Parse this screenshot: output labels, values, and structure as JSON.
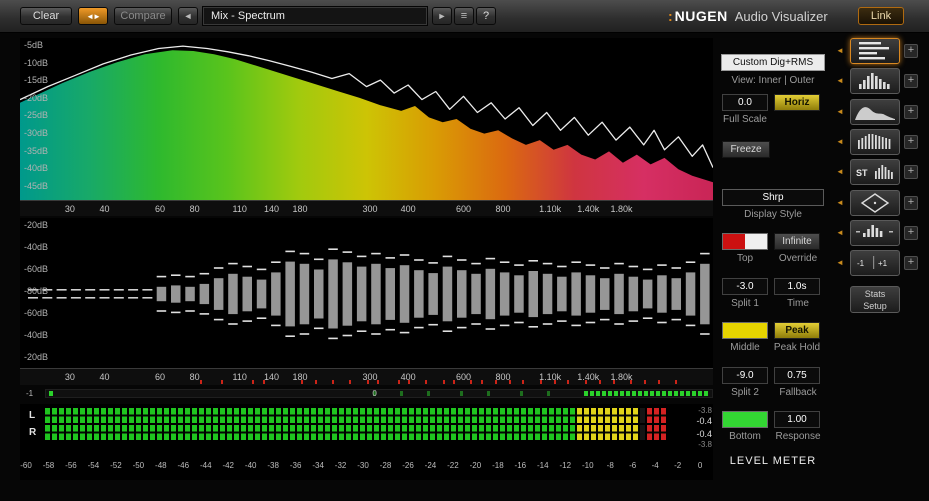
{
  "toolbar": {
    "clear": "Clear",
    "swap_glyph": "◄►",
    "compare": "Compare",
    "prev_glyph": "◄",
    "preset": "Mix - Spectrum",
    "play_glyph": "►",
    "list_glyph": "≡",
    "help": "?",
    "brand_dots": ":",
    "brand_name": "NUGEN",
    "brand_product": "Audio Visualizer",
    "link": "Link"
  },
  "spectrum": {
    "y_labels": [
      "-5dB",
      "-10dB",
      "-15dB",
      "-20dB",
      "-25dB",
      "-30dB",
      "-35dB",
      "-40dB",
      "-45dB"
    ],
    "x_labels": [
      {
        "t": "30",
        "f": 0.072
      },
      {
        "t": "40",
        "f": 0.122
      },
      {
        "t": "60",
        "f": 0.202
      },
      {
        "t": "80",
        "f": 0.252
      },
      {
        "t": "110",
        "f": 0.317
      },
      {
        "t": "140",
        "f": 0.363
      },
      {
        "t": "180",
        "f": 0.404
      },
      {
        "t": "300",
        "f": 0.505
      },
      {
        "t": "400",
        "f": 0.56
      },
      {
        "t": "600",
        "f": 0.64
      },
      {
        "t": "800",
        "f": 0.697
      },
      {
        "t": "1.10k",
        "f": 0.765
      },
      {
        "t": "1.40k",
        "f": 0.82
      },
      {
        "t": "1.80k",
        "f": 0.868
      }
    ],
    "gradient": [
      "#00998c",
      "#18a968",
      "#2eb92e",
      "#5ac41c",
      "#a0ca0e",
      "#cdc405",
      "#d99b04",
      "#db6a10",
      "#cf3540",
      "#d62f63",
      "#c92556"
    ],
    "fill_curve": [
      [
        0,
        0.4
      ],
      [
        0.03,
        0.34
      ],
      [
        0.06,
        0.28
      ],
      [
        0.1,
        0.21
      ],
      [
        0.14,
        0.15
      ],
      [
        0.18,
        0.1
      ],
      [
        0.22,
        0.075
      ],
      [
        0.25,
        0.08
      ],
      [
        0.28,
        0.1
      ],
      [
        0.31,
        0.13
      ],
      [
        0.34,
        0.17
      ],
      [
        0.37,
        0.21
      ],
      [
        0.4,
        0.25
      ],
      [
        0.43,
        0.29
      ],
      [
        0.46,
        0.33
      ],
      [
        0.49,
        0.37
      ],
      [
        0.52,
        0.415
      ],
      [
        0.55,
        0.45
      ],
      [
        0.57,
        0.42
      ],
      [
        0.59,
        0.49
      ],
      [
        0.61,
        0.52
      ],
      [
        0.63,
        0.5
      ],
      [
        0.65,
        0.56
      ],
      [
        0.67,
        0.59
      ],
      [
        0.69,
        0.57
      ],
      [
        0.71,
        0.62
      ],
      [
        0.73,
        0.66
      ],
      [
        0.75,
        0.63
      ],
      [
        0.77,
        0.69
      ],
      [
        0.79,
        0.66
      ],
      [
        0.81,
        0.72
      ],
      [
        0.83,
        0.75
      ],
      [
        0.85,
        0.7
      ],
      [
        0.87,
        0.77
      ],
      [
        0.89,
        0.72
      ],
      [
        0.91,
        0.78
      ],
      [
        0.93,
        0.74
      ],
      [
        0.95,
        0.81
      ],
      [
        0.97,
        0.85
      ],
      [
        1,
        0.89
      ]
    ],
    "line_curve": [
      [
        0,
        0.38
      ],
      [
        0.04,
        0.3
      ],
      [
        0.08,
        0.23
      ],
      [
        0.12,
        0.16
      ],
      [
        0.16,
        0.105
      ],
      [
        0.2,
        0.065
      ],
      [
        0.235,
        0.05
      ],
      [
        0.27,
        0.065
      ],
      [
        0.3,
        0.085
      ],
      [
        0.33,
        0.11
      ],
      [
        0.36,
        0.14
      ],
      [
        0.39,
        0.175
      ],
      [
        0.42,
        0.21
      ],
      [
        0.45,
        0.25
      ],
      [
        0.475,
        0.22
      ],
      [
        0.5,
        0.3
      ],
      [
        0.52,
        0.26
      ],
      [
        0.54,
        0.34
      ],
      [
        0.56,
        0.29
      ],
      [
        0.58,
        0.38
      ],
      [
        0.6,
        0.33
      ],
      [
        0.62,
        0.44
      ],
      [
        0.64,
        0.36
      ],
      [
        0.66,
        0.46
      ],
      [
        0.68,
        0.4
      ],
      [
        0.7,
        0.5
      ],
      [
        0.72,
        0.43
      ],
      [
        0.74,
        0.54
      ],
      [
        0.76,
        0.46
      ],
      [
        0.78,
        0.57
      ],
      [
        0.8,
        0.49
      ],
      [
        0.82,
        0.6
      ],
      [
        0.84,
        0.52
      ],
      [
        0.86,
        0.63
      ],
      [
        0.88,
        0.55
      ],
      [
        0.9,
        0.66
      ],
      [
        0.915,
        0.57
      ],
      [
        0.93,
        0.69
      ],
      [
        0.95,
        0.61
      ],
      [
        0.97,
        0.73
      ],
      [
        0.985,
        0.66
      ],
      [
        1,
        0.8
      ]
    ]
  },
  "histogram": {
    "y_labels": [
      "-20dB",
      "-40dB",
      "-60dB",
      "-80dB",
      "-60dB",
      "-40dB",
      "-20dB"
    ],
    "x_labels": [
      {
        "t": "30",
        "f": 0.072
      },
      {
        "t": "40",
        "f": 0.122
      },
      {
        "t": "60",
        "f": 0.202
      },
      {
        "t": "80",
        "f": 0.252
      },
      {
        "t": "110",
        "f": 0.317
      },
      {
        "t": "140",
        "f": 0.363
      },
      {
        "t": "180",
        "f": 0.404
      },
      {
        "t": "300",
        "f": 0.505
      },
      {
        "t": "400",
        "f": 0.56
      },
      {
        "t": "600",
        "f": 0.64
      },
      {
        "t": "800",
        "f": 0.697
      },
      {
        "t": "1.10k",
        "f": 0.765
      },
      {
        "t": "1.40k",
        "f": 0.82
      },
      {
        "t": "1.80k",
        "f": 0.868
      }
    ],
    "bars": [
      0.04,
      0.05,
      0.04,
      0.06,
      0.05,
      0.06,
      0.05,
      0.07,
      0.06,
      0.1,
      0.12,
      0.1,
      0.14,
      0.22,
      0.28,
      0.24,
      0.2,
      0.3,
      0.45,
      0.42,
      0.34,
      0.48,
      0.44,
      0.38,
      0.42,
      0.36,
      0.4,
      0.33,
      0.29,
      0.38,
      0.33,
      0.28,
      0.35,
      0.3,
      0.26,
      0.32,
      0.28,
      0.24,
      0.3,
      0.26,
      0.22,
      0.28,
      0.24,
      0.2,
      0.26,
      0.22,
      0.3,
      0.42
    ],
    "red_ticks": [
      0.26,
      0.29,
      0.335,
      0.35,
      0.405,
      0.425,
      0.45,
      0.475,
      0.5,
      0.515,
      0.545,
      0.56,
      0.585,
      0.61,
      0.625,
      0.65,
      0.665,
      0.685,
      0.705,
      0.725,
      0.75,
      0.77,
      0.79,
      0.815,
      0.835,
      0.855,
      0.88,
      0.9,
      0.92,
      0.945
    ]
  },
  "corr": {
    "min_label": "-1",
    "zero_label": "0",
    "zero_frac": 0.49,
    "green_from": 0.805,
    "ticks_dim": [
      0.49,
      0.53,
      0.57,
      0.62,
      0.66,
      0.71,
      0.75
    ],
    "ticks_bright": [
      0.004
    ]
  },
  "meter": {
    "channels": [
      "L",
      "R"
    ],
    "values": [
      "-3.8",
      "-0.4",
      "-0.4",
      "-3.8"
    ],
    "scale": [
      "-60",
      "-58",
      "-56",
      "-54",
      "-52",
      "-50",
      "-48",
      "-46",
      "-44",
      "-42",
      "-40",
      "-38",
      "-36",
      "-34",
      "-32",
      "-30",
      "-28",
      "-26",
      "-24",
      "-22",
      "-20",
      "-18",
      "-16",
      "-14",
      "-12",
      "-10",
      "-8",
      "-6",
      "-4",
      "-2",
      "0"
    ],
    "segments": {
      "count": 89,
      "green_until": 76,
      "yellow_until": 85,
      "gap_until": 86,
      "red_until": 89
    }
  },
  "controls": {
    "mode": "Custom Dig+RMS",
    "view": "View: Inner | Outer",
    "full_scale_value": "0.0",
    "horiz": "Horiz",
    "full_scale_label": "Full Scale",
    "freeze": "Freeze",
    "display_style_value": "Shrp",
    "display_style_label": "Display Style",
    "infinite": "Infinite",
    "top_label": "Top",
    "override_label": "Override",
    "split1_value": "-3.0",
    "split1_label": "Split 1",
    "time_value": "1.0s",
    "time_label": "Time",
    "peak": "Peak",
    "middle_label": "Middle",
    "peak_hold_label": "Peak Hold",
    "split2_value": "-9.0",
    "split2_label": "Split 2",
    "fallback_value": "0.75",
    "fallback_label": "Fallback",
    "response_value": "1.00",
    "bottom_label": "Bottom",
    "response_label": "Response",
    "level_meter_label": "LEVEL METER"
  },
  "sidebar": {
    "arrow_glyph": "◄",
    "plus_glyph": "+",
    "items": [
      {
        "icon": "meter-lines",
        "selected": true
      },
      {
        "icon": "spectrum-bars",
        "selected": false
      },
      {
        "icon": "spectrum-wave",
        "selected": false
      },
      {
        "icon": "dense-stripes",
        "selected": false
      },
      {
        "icon": "st-stripes",
        "selected": false,
        "label": "ST"
      },
      {
        "icon": "diamond",
        "selected": false
      },
      {
        "icon": "mini-histogram",
        "selected": false
      },
      {
        "icon": "plus-minus",
        "selected": false,
        "label_left": "-1",
        "label_right": "+1"
      }
    ],
    "stats_line1": "Stats",
    "stats_line2": "Setup"
  },
  "colors": {
    "accent_orange": "#d98821",
    "meter_green": "#1fc51f",
    "meter_yellow": "#e0d41a",
    "meter_red": "#d42222",
    "swatch_red": "#cc1111",
    "swatch_white": "#f0f0f0",
    "swatch_yellow": "#e6d400",
    "swatch_green": "#33d633"
  }
}
